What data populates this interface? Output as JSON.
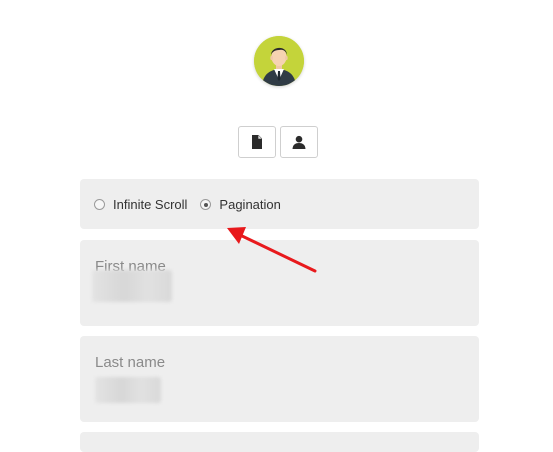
{
  "profile": {
    "avatar_icon": "user-avatar-icon",
    "avatar_bg": "#c4d43a"
  },
  "toolbar": {
    "buttons": [
      {
        "icon": "document-icon"
      },
      {
        "icon": "user-icon"
      }
    ]
  },
  "scroll_mode": {
    "options": [
      "Infinite Scroll",
      "Pagination"
    ],
    "selected": "Pagination"
  },
  "form": {
    "first_name": {
      "label": "First name"
    },
    "last_name": {
      "label": "Last name"
    }
  },
  "annotation": {
    "arrow_color": "#e8191c"
  }
}
